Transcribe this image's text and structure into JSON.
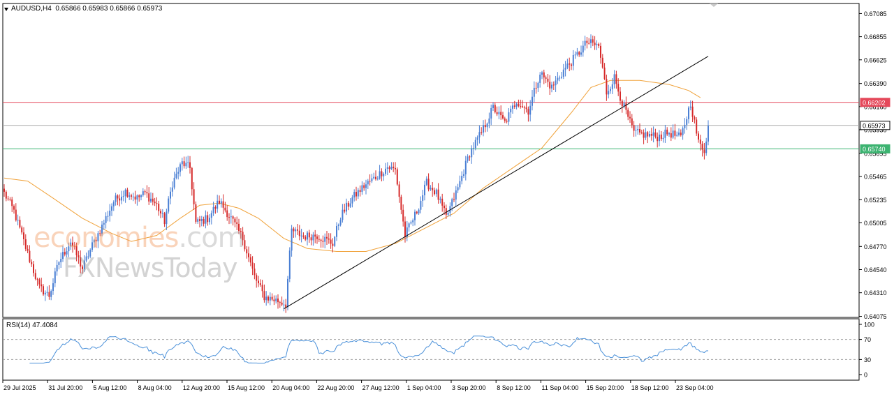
{
  "header": {
    "symbol": "AUDUSD,H4",
    "ohlc": "0.65866 0.65983 0.65866 0.65973"
  },
  "watermark": {
    "line1_brand": "economies",
    "line1_suffix": ".com",
    "line2": "FXNewsToday"
  },
  "colors": {
    "bull": "#4a7fd4",
    "bear": "#d62a2a",
    "ma": "#f0a23a",
    "resistance": "#e5485a",
    "support": "#3cb371",
    "current": "#aaaaaa",
    "trendline": "#000000",
    "rsi": "#4a90d9"
  },
  "chart_data": [
    {
      "type": "candlestick",
      "symbol": "AUDUSD",
      "timeframe": "H4",
      "y_ticks": [
        "0.67085",
        "0.66855",
        "0.66625",
        "0.66390",
        "0.66160",
        "0.65930",
        "0.65695",
        "0.65465",
        "0.65235",
        "0.65005",
        "0.64770",
        "0.64540",
        "0.64310",
        "0.64075"
      ],
      "x_ticks": [
        "29 Jul 2025",
        "31 Jul 20:00",
        "5 Aug 12:00",
        "8 Aug 04:00",
        "12 Aug 20:00",
        "15 Aug 12:00",
        "20 Aug 04:00",
        "22 Aug 20:00",
        "27 Aug 12:00",
        "1 Sep 04:00",
        "3 Sep 20:00",
        "8 Sep 12:00",
        "11 Sep 04:00",
        "15 Sep 20:00",
        "18 Sep 12:00",
        "23 Sep 04:00"
      ],
      "ylim": [
        0.64065,
        0.67185
      ],
      "price_labels": {
        "resistance": "0.66202",
        "current": "0.65973",
        "support": "0.65740"
      },
      "horizontal_lines": [
        0.66202,
        0.65973,
        0.6574
      ],
      "trendline": {
        "from": {
          "bar": 143,
          "price": 0.6415
        },
        "to": {
          "bar": 360,
          "price": 0.6666
        }
      },
      "close_anchors": [
        [
          0,
          0.653
        ],
        [
          5,
          0.6512
        ],
        [
          12,
          0.647
        ],
        [
          18,
          0.6436
        ],
        [
          23,
          0.6428
        ],
        [
          28,
          0.6462
        ],
        [
          34,
          0.6482
        ],
        [
          40,
          0.6455
        ],
        [
          45,
          0.6478
        ],
        [
          50,
          0.6497
        ],
        [
          56,
          0.6522
        ],
        [
          62,
          0.6532
        ],
        [
          68,
          0.6525
        ],
        [
          72,
          0.653
        ],
        [
          78,
          0.6518
        ],
        [
          82,
          0.6502
        ],
        [
          86,
          0.654
        ],
        [
          91,
          0.656
        ],
        [
          95,
          0.6555
        ],
        [
          98,
          0.65
        ],
        [
          104,
          0.6505
        ],
        [
          110,
          0.6522
        ],
        [
          116,
          0.6505
        ],
        [
          122,
          0.6485
        ],
        [
          128,
          0.6447
        ],
        [
          133,
          0.6427
        ],
        [
          140,
          0.6423
        ],
        [
          144,
          0.642
        ],
        [
          147,
          0.6493
        ],
        [
          153,
          0.6487
        ],
        [
          160,
          0.6488
        ],
        [
          168,
          0.648
        ],
        [
          172,
          0.6507
        ],
        [
          178,
          0.6525
        ],
        [
          184,
          0.6537
        ],
        [
          190,
          0.6546
        ],
        [
          196,
          0.6556
        ],
        [
          200,
          0.6553
        ],
        [
          205,
          0.6488
        ],
        [
          211,
          0.6512
        ],
        [
          216,
          0.654
        ],
        [
          221,
          0.653
        ],
        [
          226,
          0.6506
        ],
        [
          232,
          0.6535
        ],
        [
          238,
          0.657
        ],
        [
          244,
          0.659
        ],
        [
          250,
          0.6615
        ],
        [
          256,
          0.66
        ],
        [
          262,
          0.6622
        ],
        [
          268,
          0.6612
        ],
        [
          274,
          0.665
        ],
        [
          280,
          0.6635
        ],
        [
          286,
          0.6652
        ],
        [
          292,
          0.6665
        ],
        [
          298,
          0.668
        ],
        [
          304,
          0.6676
        ],
        [
          308,
          0.663
        ],
        [
          312,
          0.6645
        ],
        [
          316,
          0.662
        ],
        [
          322,
          0.659
        ],
        [
          328,
          0.6588
        ],
        [
          334,
          0.6586
        ],
        [
          340,
          0.659
        ],
        [
          346,
          0.6585
        ],
        [
          351,
          0.662
        ],
        [
          355,
          0.658
        ],
        [
          358,
          0.6573
        ],
        [
          360,
          0.6597
        ]
      ],
      "moving_average": [
        [
          0,
          0.6545
        ],
        [
          12,
          0.6542
        ],
        [
          25,
          0.6525
        ],
        [
          40,
          0.6505
        ],
        [
          55,
          0.649
        ],
        [
          65,
          0.6482
        ],
        [
          78,
          0.6488
        ],
        [
          90,
          0.6505
        ],
        [
          100,
          0.6518
        ],
        [
          110,
          0.652
        ],
        [
          120,
          0.6515
        ],
        [
          130,
          0.6505
        ],
        [
          143,
          0.6485
        ],
        [
          155,
          0.6475
        ],
        [
          170,
          0.6472
        ],
        [
          185,
          0.6472
        ],
        [
          200,
          0.648
        ],
        [
          215,
          0.6495
        ],
        [
          230,
          0.651
        ],
        [
          245,
          0.6535
        ],
        [
          260,
          0.6555
        ],
        [
          275,
          0.6575
        ],
        [
          290,
          0.661
        ],
        [
          300,
          0.6635
        ],
        [
          310,
          0.6642
        ],
        [
          325,
          0.6642
        ],
        [
          340,
          0.6638
        ],
        [
          350,
          0.6632
        ],
        [
          356,
          0.6625
        ]
      ],
      "total_bars": 361
    },
    {
      "type": "line",
      "indicator": "RSI",
      "period": 14,
      "label": "RSI(14) 47.4084",
      "value": 47.4084,
      "ylim": [
        0,
        100
      ],
      "y_ticks": [
        "100",
        "70",
        "30",
        "0"
      ],
      "levels": [
        70,
        30
      ]
    }
  ]
}
